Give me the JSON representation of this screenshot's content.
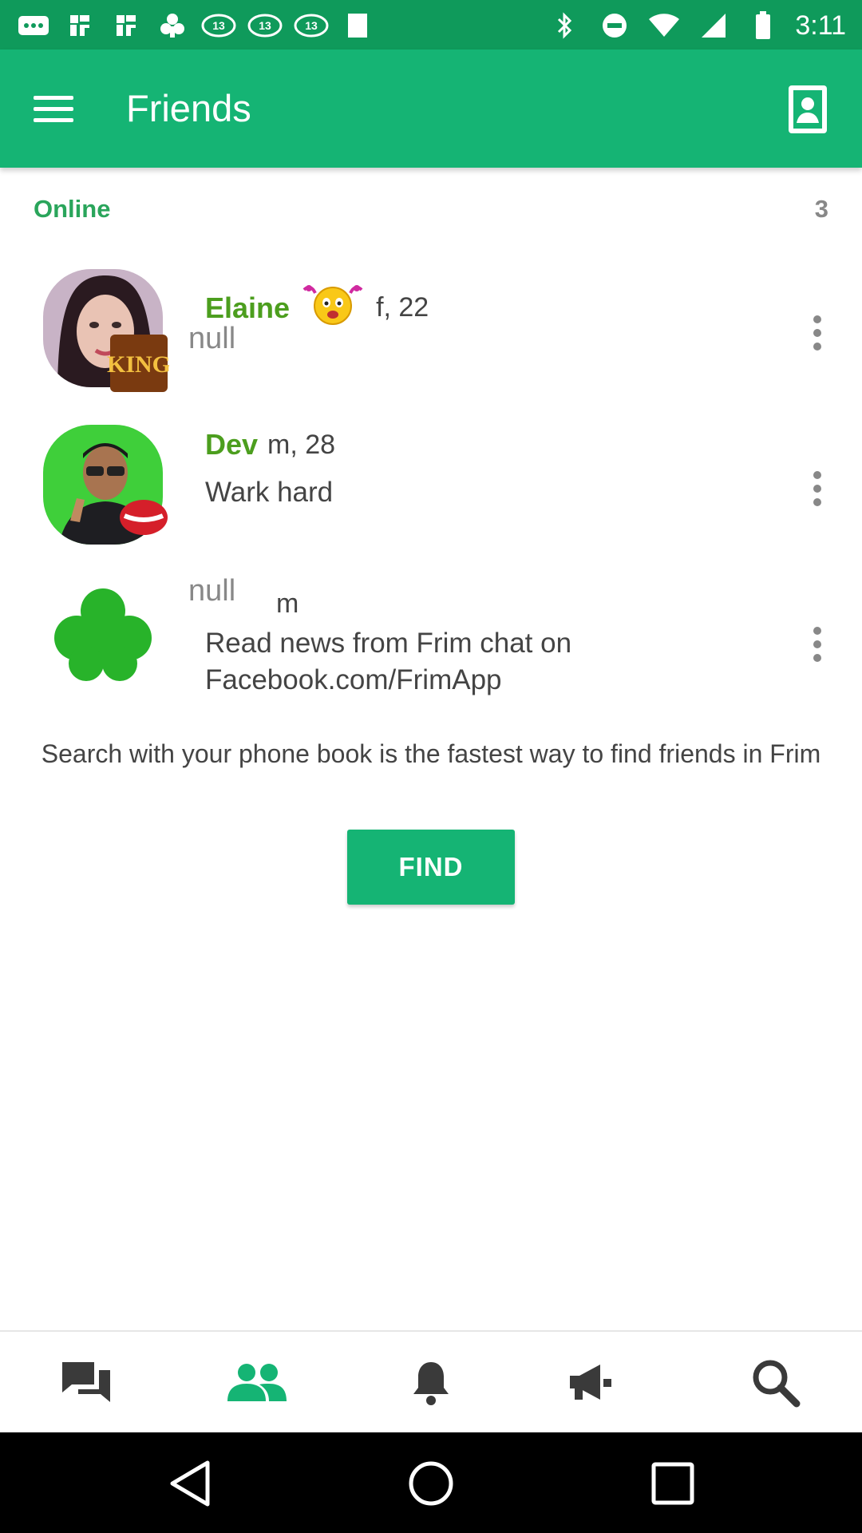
{
  "status_bar": {
    "time": "3:11",
    "left_icons": [
      "more-icon",
      "pinwheel-icon",
      "pinwheel-icon",
      "frim-icon",
      "abc13-icon",
      "abc13-icon",
      "abc13-icon",
      "stop-icon"
    ],
    "right_icons": [
      "bluetooth-icon",
      "do-not-disturb-icon",
      "wifi-icon",
      "signal-icon",
      "battery-icon"
    ]
  },
  "app_bar": {
    "title": "Friends",
    "color": "#15b474"
  },
  "section": {
    "label": "Online",
    "count": "3"
  },
  "friends": [
    {
      "name": "Elaine",
      "meta": "f, 22",
      "secondary": "null",
      "badge": "KING",
      "has_emoji": true
    },
    {
      "name": "Dev",
      "meta": "m, 28",
      "status": "Wark hard"
    },
    {
      "name": "null",
      "meta": "m",
      "status": "Read news from Frim chat on Facebook.com/FrimApp"
    }
  ],
  "hint_text": "Search with your phone book is the fastest way to find friends in Frim",
  "find_button": "FIND",
  "bottom_nav": {
    "items": [
      "chat-icon",
      "friends-icon",
      "bell-icon",
      "megaphone-icon",
      "search-icon"
    ],
    "active": "friends-icon",
    "active_color": "#15b474",
    "inactive_color": "#3a3a3a"
  }
}
